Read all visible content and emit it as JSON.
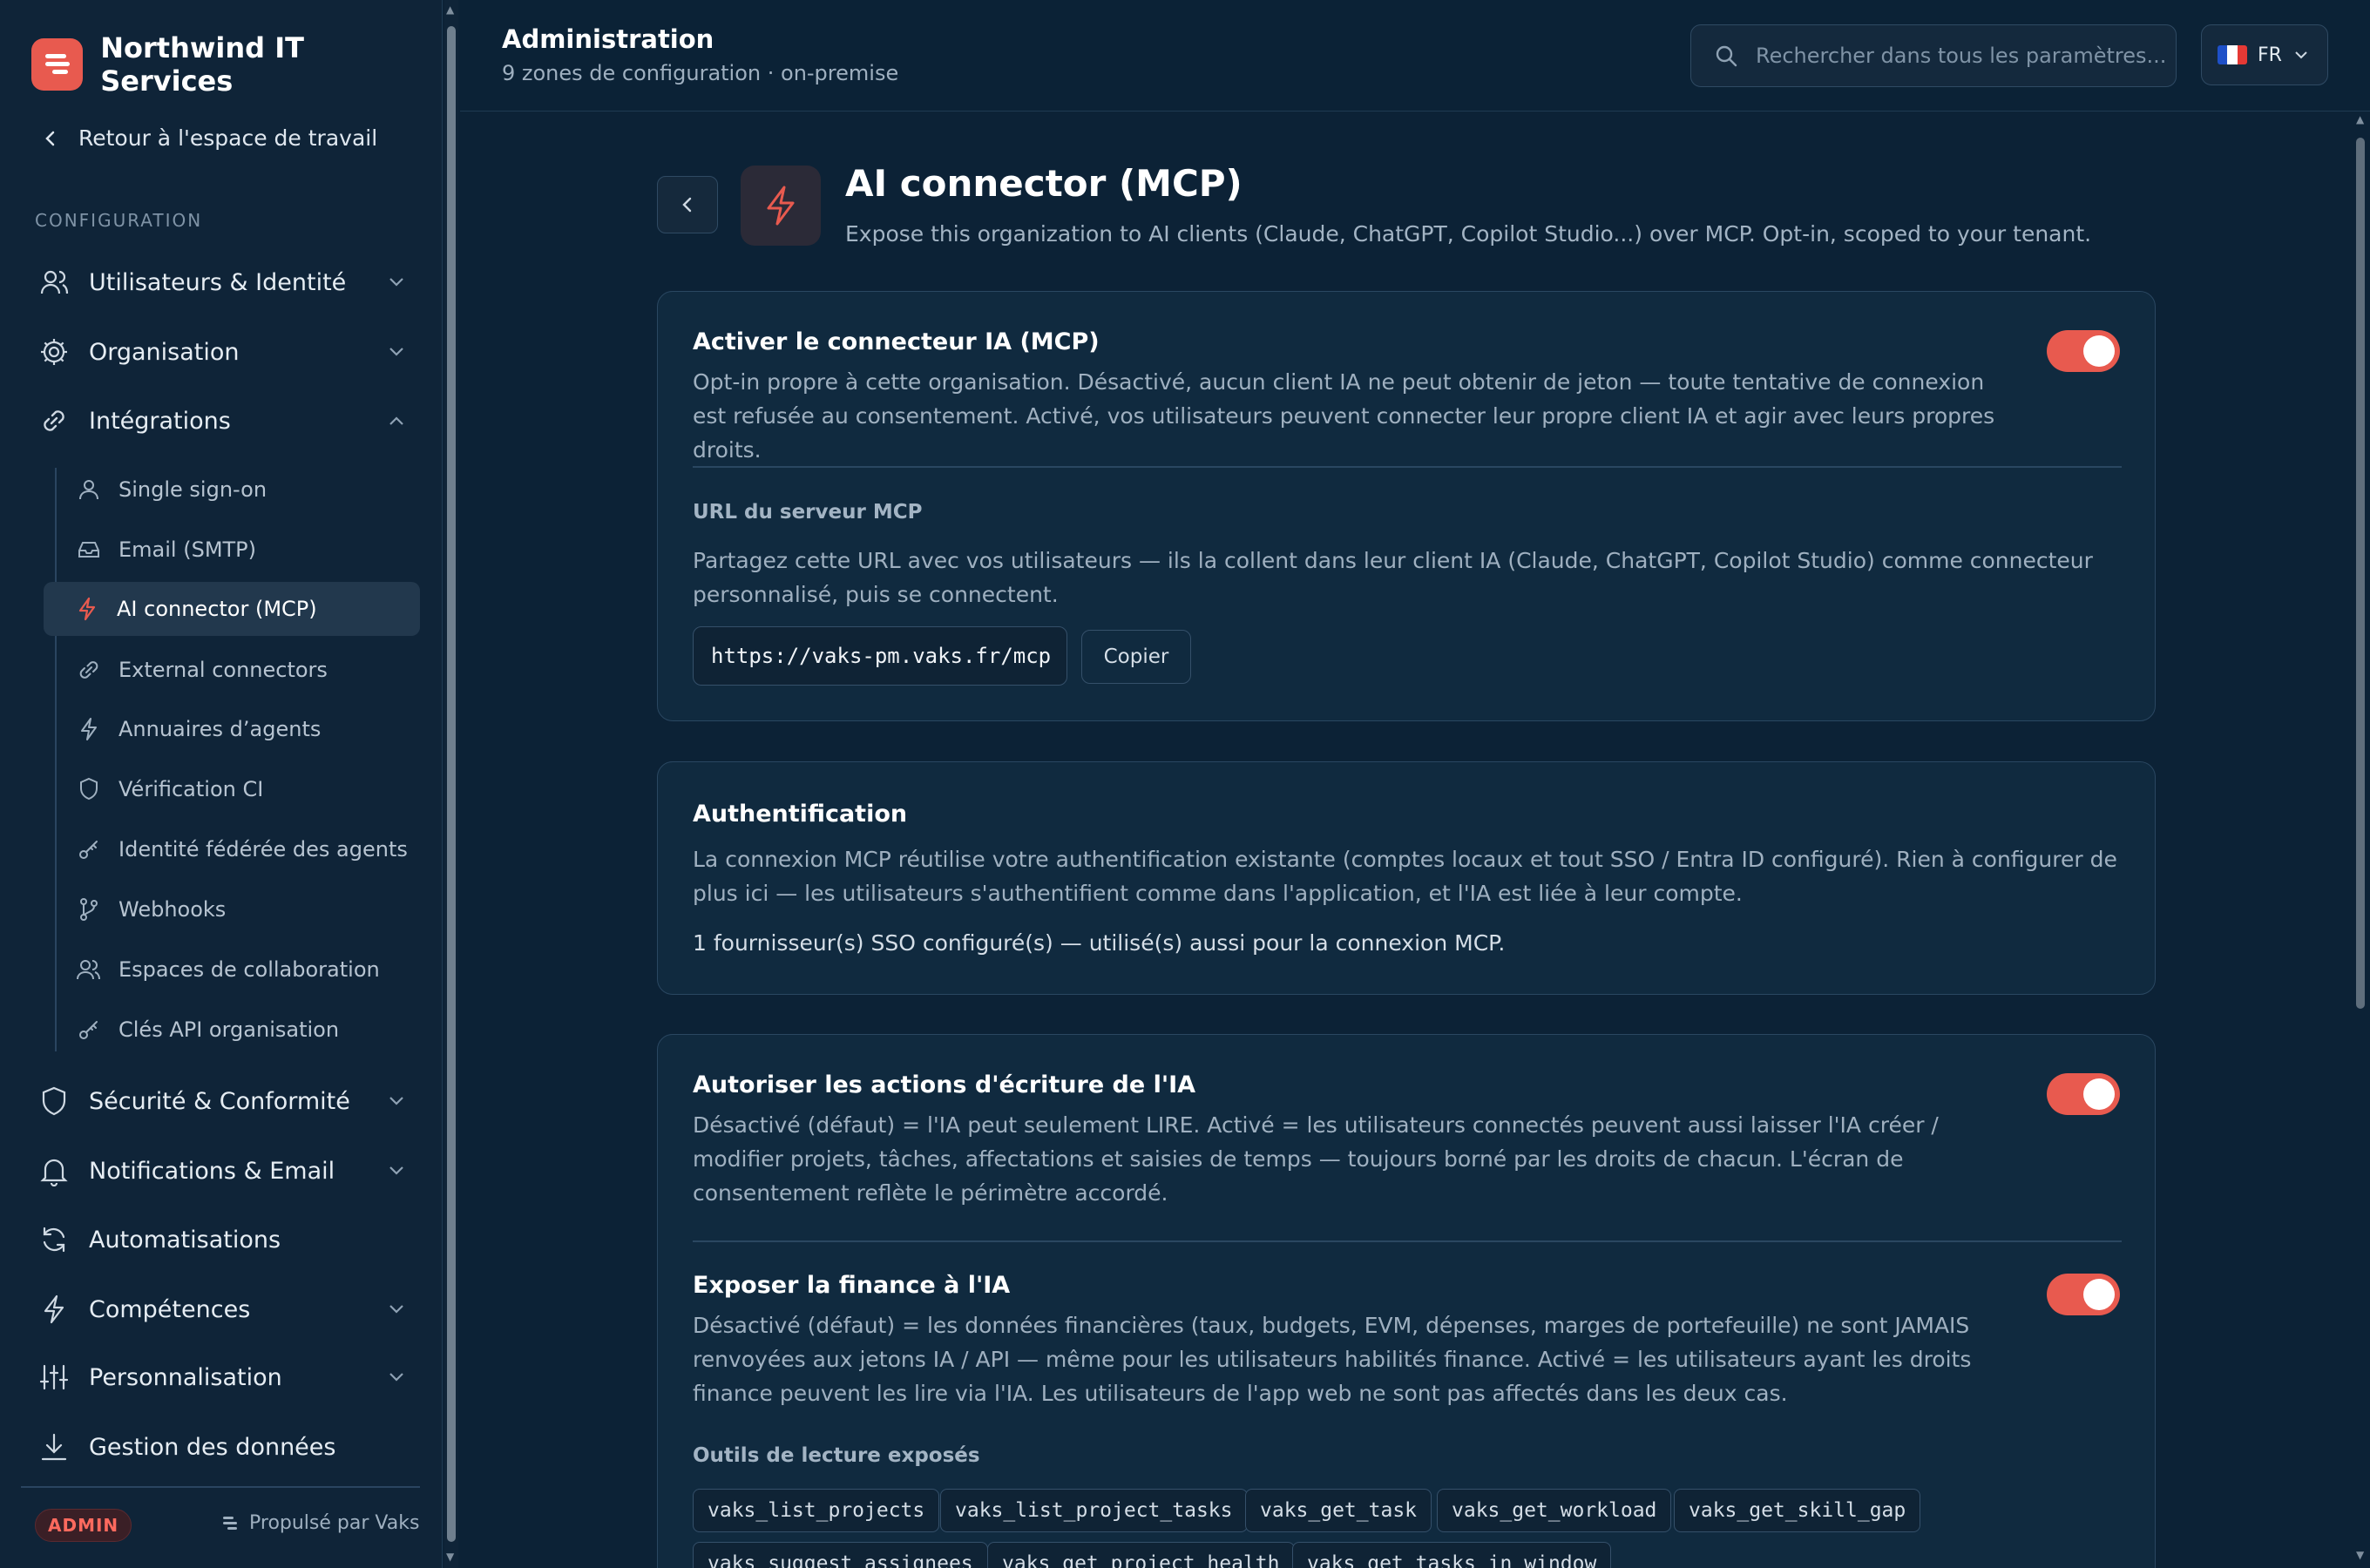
{
  "brand": {
    "name": "Northwind IT Services"
  },
  "sidebar": {
    "back_label": "Retour à l'espace de travail",
    "section_label": "CONFIGURATION",
    "groups": [
      {
        "label": "Utilisateurs & Identité",
        "icon": "users-icon"
      },
      {
        "label": "Organisation",
        "icon": "gear-icon"
      },
      {
        "label": "Intégrations",
        "icon": "link-icon"
      },
      {
        "label": "Sécurité & Conformité",
        "icon": "shield-icon"
      },
      {
        "label": "Notifications & Email",
        "icon": "bell-icon"
      },
      {
        "label": "Automatisations",
        "icon": "refresh-icon"
      },
      {
        "label": "Compétences",
        "icon": "bolt-icon"
      },
      {
        "label": "Personnalisation",
        "icon": "sliders-icon"
      },
      {
        "label": "Gestion des données",
        "icon": "download-icon"
      }
    ],
    "sub_items": [
      {
        "label": "Single sign-on",
        "icon": "user-icon"
      },
      {
        "label": "Email (SMTP)",
        "icon": "inbox-icon"
      },
      {
        "label": "AI connector (MCP)",
        "icon": "bolt-icon",
        "active": true
      },
      {
        "label": "External connectors",
        "icon": "link-icon"
      },
      {
        "label": "Annuaires d’agents",
        "icon": "bolt-icon"
      },
      {
        "label": "Vérification CI",
        "icon": "shield-icon"
      },
      {
        "label": "Identité fédérée des agents",
        "icon": "key-icon"
      },
      {
        "label": "Webhooks",
        "icon": "git-branch-icon"
      },
      {
        "label": "Espaces de collaboration",
        "icon": "users-icon"
      },
      {
        "label": "Clés API organisation",
        "icon": "key-icon"
      }
    ],
    "badge": "ADMIN",
    "powered": "Propulsé par Vaks"
  },
  "header": {
    "title": "Administration",
    "subtitle": "9 zones de configuration · on-premise",
    "search_placeholder": "Rechercher dans tous les paramètres...",
    "lang": "FR"
  },
  "page": {
    "title": "AI connector (MCP)",
    "description": "Expose this organization to AI clients (Claude, ChatGPT, Copilot Studio...) over MCP. Opt-in, scoped to your tenant."
  },
  "card_mcp": {
    "title": "Activer le connecteur IA (MCP)",
    "text": "Opt-in propre à cette organisation. Désactivé, aucun client IA ne peut obtenir de jeton — toute tentative de connexion est refusée au consentement. Activé, vos utilisateurs peuvent connecter leur propre client IA et agir avec leurs propres droits.",
    "enabled": true,
    "url_label": "URL du serveur MCP",
    "url_help": "Partagez cette URL avec vos utilisateurs — ils la collent dans leur client IA (Claude, ChatGPT, Copilot Studio) comme connecteur personnalisé, puis se connectent.",
    "url": "https://vaks-pm.vaks.fr/mcp",
    "copy_label": "Copier"
  },
  "card_auth": {
    "title": "Authentification",
    "text": "La connexion MCP réutilise votre authentification existante (comptes locaux et tout SSO / Entra ID configuré). Rien à configurer de plus ici — les utilisateurs s'authentifient comme dans l'application, et l'IA est liée à leur compte.",
    "status": "1 fournisseur(s) SSO configuré(s) — utilisé(s) aussi pour la connexion MCP."
  },
  "card_perms": {
    "write_title": "Autoriser les actions d'écriture de l'IA",
    "write_text": "Désactivé (défaut) = l'IA peut seulement LIRE. Activé = les utilisateurs connectés peuvent aussi laisser l'IA créer / modifier projets, tâches, affectations et saisies de temps — toujours borné par les droits de chacun. L'écran de consentement reflète le périmètre accordé.",
    "write_enabled": true,
    "finance_title": "Exposer la finance à l'IA",
    "finance_text": "Désactivé (défaut) = les données financières (taux, budgets, EVM, dépenses, marges de portefeuille) ne sont JAMAIS renvoyées aux jetons IA / API — même pour les utilisateurs habilités finance. Activé = les utilisateurs ayant les droits finance peuvent les lire via l'IA. Les utilisateurs de l'app web ne sont pas affectés dans les deux cas.",
    "finance_enabled": true,
    "tools_label": "Outils de lecture exposés",
    "tools": [
      "vaks_list_projects",
      "vaks_list_project_tasks",
      "vaks_get_task",
      "vaks_get_workload",
      "vaks_get_skill_gap",
      "vaks_suggest_assignees",
      "vaks_get_project_health",
      "vaks_get_tasks_in_window"
    ]
  },
  "colors": {
    "accent": "#e85a4f",
    "background": "#0c2236",
    "card": "#102a3f"
  }
}
